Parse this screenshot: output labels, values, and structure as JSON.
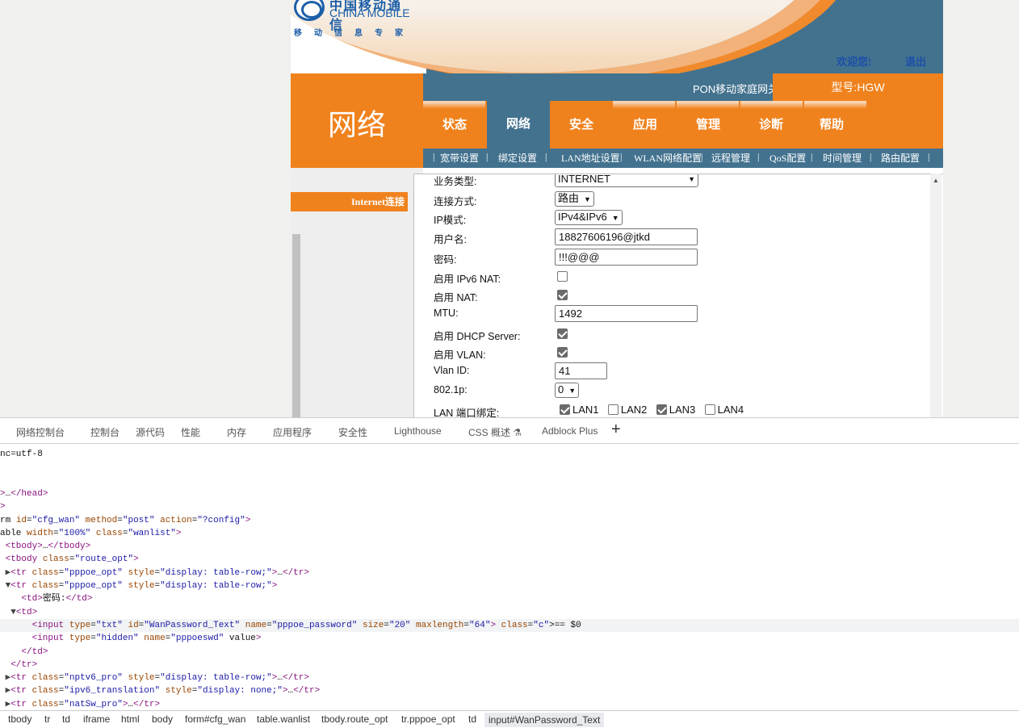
{
  "header": {
    "logo_cn": "中国移动通信",
    "logo_en": "CHINA MOBILE",
    "logo_sub": "移动信息专家",
    "welcome": "欢迎您!",
    "logout": "退出",
    "product": "PON移动家庭网关",
    "model": "型号:HGW"
  },
  "section_title": "网络",
  "menu": [
    "状态",
    "网络",
    "安全",
    "应用",
    "管理",
    "诊断",
    "帮助"
  ],
  "submenu": [
    "|",
    "宽带设置",
    "|",
    "绑定设置",
    "|",
    "LAN地址设置",
    "|",
    "WLAN网络配置",
    "|",
    "远程管理",
    "|",
    "QoS配置",
    "|",
    "时间管理",
    "|",
    "路由配置",
    "|"
  ],
  "leftnav": {
    "item": "Internet连接"
  },
  "form": {
    "service_label": "业务类型:",
    "service_value": "INTERNET",
    "mode_label": "连接方式:",
    "mode_value": "路由",
    "ip_label": "IP模式:",
    "ip_value": "IPv4&IPv6",
    "user_label": "用户名:",
    "user_value": "18827606196@jtkd",
    "pwd_label": "密码:",
    "pwd_value": "!!!@@@",
    "ipv6nat_label": "启用 IPv6 NAT:",
    "nat_label": "启用 NAT:",
    "mtu_label": "MTU:",
    "mtu_value": "1492",
    "dhcp_label": "启用 DHCP Server:",
    "vlan_label": "启用 VLAN:",
    "vlanid_label": "Vlan ID:",
    "vlanid_value": "41",
    "p8021_label": "802.1p:",
    "p8021_value": "0",
    "lan_label": "LAN 端口绑定:",
    "lan1": "LAN1",
    "lan2": "LAN2",
    "lan3": "LAN3",
    "lan4": "LAN4"
  },
  "checks": {
    "ipv6nat": false,
    "nat": true,
    "dhcp": true,
    "vlan": true,
    "lan1": true,
    "lan2": false,
    "lan3": true,
    "lan4": false
  },
  "devtools": {
    "tabs": [
      "网络控制台",
      "控制台",
      "源代码",
      "性能",
      "内存",
      "应用程序",
      "安全性",
      "Lighthouse",
      "CSS 概述 ⚗",
      "Adblock Plus",
      "+"
    ],
    "breadcrumbs": [
      "tbody",
      "tr",
      "td",
      "iframe",
      "html",
      "body",
      "form#cfg_wan",
      "table.wanlist",
      "tbody.route_opt",
      "tr.pppoe_opt",
      "td",
      "input#WanPassword_Text"
    ],
    "lines": [
      "nc=utf-8",
      "",
      "",
      ">…</head>",
      ">",
      "rm id=\"cfg_wan\" method=\"post\" action=\"?config\">",
      "able width=\"100%\" class=\"wanlist\">",
      " <tbody>…</tbody>",
      " <tbody class=\"route_opt\">",
      " ▶<tr class=\"pppoe_opt\" style=\"display: table-row;\">…</tr>",
      " ▼<tr class=\"pppoe_opt\" style=\"display: table-row;\">",
      "    <td>密码:</td>",
      "  ▼<td>",
      "      <input type=\"txt\" id=\"WanPassword_Text\" name=\"pppoe_password\" size=\"20\" maxlength=\"64\"> == $0",
      "      <input type=\"hidden\" name=\"pppoeswd\" value>",
      "    </td>",
      "  </tr>",
      " ▶<tr class=\"nptv6_pro\" style=\"display: table-row;\">…</tr>",
      " ▶<tr class=\"ipv6_translation\" style=\"display: none;\">…</tr>",
      " ▶<tr class=\"natSw_pro\">…</tr>"
    ]
  }
}
